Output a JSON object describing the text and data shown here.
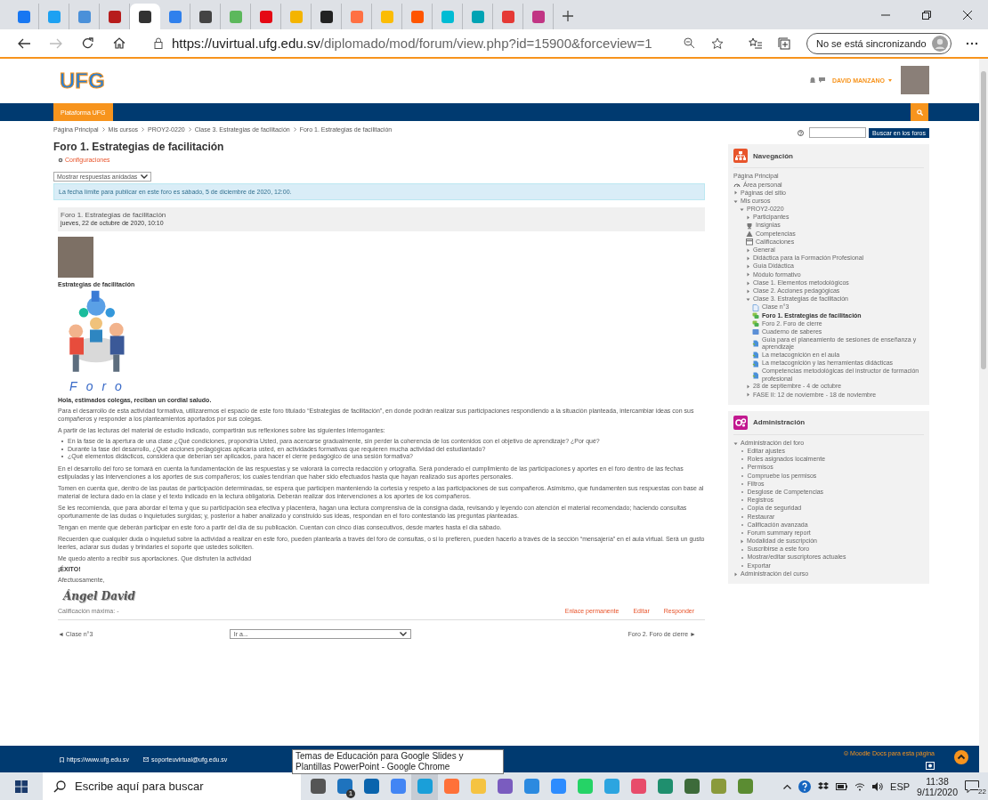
{
  "browser": {
    "tabs": [
      {
        "selected": false,
        "color": "#1877f2"
      },
      {
        "selected": false,
        "color": "#1da1f2"
      },
      {
        "selected": false,
        "color": "#4a90d9"
      },
      {
        "selected": false,
        "color": "#b71c1c"
      },
      {
        "selected": true,
        "color": "#333333"
      },
      {
        "selected": false,
        "color": "#2f80ed"
      },
      {
        "selected": false,
        "color": "#444444"
      },
      {
        "selected": false,
        "color": "#5cb85c"
      },
      {
        "selected": false,
        "color": "#e50914"
      },
      {
        "selected": false,
        "color": "#f4b400"
      },
      {
        "selected": false,
        "color": "#222222"
      },
      {
        "selected": false,
        "color": "#ff7043"
      },
      {
        "selected": false,
        "color": "#fbbc05"
      },
      {
        "selected": false,
        "color": "#ff5500"
      },
      {
        "selected": false,
        "color": "#00bcd4"
      },
      {
        "selected": false,
        "color": "#00a3b4"
      },
      {
        "selected": false,
        "color": "#e53935"
      },
      {
        "selected": false,
        "color": "#c13584"
      }
    ],
    "url_host": "https://uvirtual.ufg.edu.sv",
    "url_path": "/diplomado/mod/forum/view.php?id=15900&forceview=1",
    "sync_status": "No se está sincronizando"
  },
  "site_header": {
    "logo": "UFG",
    "user_name": "DAVID MANZANO"
  },
  "nav_bar": {
    "home_button": "Plataforma UFG"
  },
  "breadcrumb": [
    "Página Principal",
    "Mis cursos",
    "PROY2-0220",
    "Clase 3. Estrategias de facilitación",
    "Foro 1. Estrategias de facilitación"
  ],
  "forum_search": {
    "button": "Buscar en los foros"
  },
  "page_title": "Foro 1. Estrategias de facilitación",
  "settings_link": "Configuraciones",
  "display_mode": "Mostrar respuestas anidadas",
  "notice": "La fecha límite para publicar en este foro es sábado, 5 de diciembre de 2020, 12:00.",
  "post": {
    "subject": "Foro 1. Estrategias de facilitación",
    "date": "jueves, 22 de octubre de 2020, 10:10",
    "heading": "Estrategias de facilitación",
    "illustration_caption": "Foro",
    "blocks": [
      {
        "kind": "strong",
        "text": "Hola, estimados colegas, reciban un cordial saludo."
      },
      {
        "kind": "paragraph",
        "text": "Para el desarrollo de esta actividad formativa, utilizaremos el espacio de este foro titulado “Estrategias de facilitación”, en donde podrán realizar sus participaciones respondiendo a la situación planteada, intercambiar ideas con sus compañeros y responder a los planteamientos aportados por sus colegas."
      },
      {
        "kind": "paragraph",
        "text": "A partir de las lecturas del material de estudio indicado, compartirán sus reflexiones sobre las siguientes interrogantes:"
      },
      {
        "kind": "list",
        "items": [
          "En la fase de la apertura de una clase ¿Qué condiciones, propondría Usted, para acercarse gradualmente, sin perder la coherencia de los contenidos con el objetivo de aprendizaje? ¿Por qué?",
          "Durante la fase del desarrollo, ¿Qué acciones pedagógicas aplicaría usted, en actividades formativas que requieren mucha actividad del estudiantado?",
          "¿Qué elementos didácticos, considera que deberían ser aplicados, para hacer el cierre pedagógico de una sesión formativa?"
        ]
      },
      {
        "kind": "paragraph",
        "text": "En el desarrollo del foro se tomará en cuenta la fundamentación de las respuestas y se valorará la correcta redacción y ortografía. Será ponderado el cumplimiento de las participaciones y aportes en el foro dentro de las fechas estipuladas y las intervenciones a los aportes de sus compañeros; los cuales tendrían que haber sido efectuados hasta que hayan realizado sus aportes personales."
      },
      {
        "kind": "paragraph",
        "text": "Tomen en cuenta que, dentro de las pautas de participación determinadas, se espera que participen manteniendo la cortesía y respeto a las participaciones de sus compañeros. Asimismo, que fundamenten sus respuestas con base al material de lectura dado en la clase y el texto indicado en la lectura obligatoria. Deberán realizar dos intervenciones a los aportes de los compañeros."
      },
      {
        "kind": "paragraph",
        "text": "Se les recomienda, que para abordar el tema y que su participación sea efectiva y placentera, hagan una lectura comprensiva de la consigna dada, revisando y leyendo con atención el material recomendado; haciendo consultas oportunamente de las dudas o inquietudes surgidas; y, posterior a haber analizado y construido sus ideas, respondan en el foro contestando las preguntas planteadas."
      },
      {
        "kind": "paragraph",
        "text": "Tengan en mente que deberán participar en este foro a partir del día de su publicación. Cuentan con cinco días consecutivos, desde martes hasta el día sábado."
      },
      {
        "kind": "paragraph",
        "text": "Recuerden que cualquier duda o inquietud sobre la actividad a realizar en este foro, pueden plantearla a través del foro de consultas, o si lo prefieren, pueden hacerlo a través de la sección “mensajería” en el aula virtual. Será un gusto leerles, aclarar sus dudas y brindarles el soporte que ustedes soliciten."
      },
      {
        "kind": "paragraph",
        "text": "Me quedo atento a recibir sus aportaciones. Que disfruten la actividad"
      },
      {
        "kind": "strong",
        "text": "¡ÉXITO!"
      },
      {
        "kind": "paragraph",
        "text": "Afectuosamente,"
      }
    ],
    "signature": "Ángel David",
    "grade": "Calificación máxima: -",
    "actions": [
      "Enlace permanente",
      "Editar",
      "Responder"
    ]
  },
  "pager": {
    "previous": "◄ Clase n°3",
    "jump": "Ir a...",
    "next": "Foro 2. Foro de cierre ►"
  },
  "navigation": {
    "title": "Navegación",
    "items": [
      {
        "kind": "link",
        "label": "Página Principal",
        "selected": false
      },
      {
        "kind": "dashboard",
        "label": "Área personal",
        "selected": false
      },
      {
        "kind": "branch",
        "label": "Páginas del sitio",
        "expanded": false,
        "selected": false
      },
      {
        "kind": "branch",
        "label": "Mis cursos",
        "expanded": true,
        "selected": false,
        "children": [
          {
            "kind": "branch",
            "label": "PROY2-0220",
            "expanded": true,
            "selected": false,
            "children": [
              {
                "kind": "branch",
                "label": "Participantes",
                "expanded": false,
                "selected": false
              },
              {
                "kind": "badge",
                "label": "Insignias",
                "selected": false
              },
              {
                "kind": "competency",
                "label": "Competencias",
                "selected": false
              },
              {
                "kind": "grades",
                "label": "Calificaciones",
                "selected": false
              },
              {
                "kind": "branch",
                "label": "General",
                "expanded": false,
                "selected": false
              },
              {
                "kind": "branch",
                "label": "Didáctica para la Formación Profesional",
                "expanded": false,
                "selected": false
              },
              {
                "kind": "branch",
                "label": "Guía Didáctica",
                "expanded": false,
                "selected": false
              },
              {
                "kind": "branch",
                "label": "Módulo formativo",
                "expanded": false,
                "selected": false
              },
              {
                "kind": "branch",
                "label": "Clase 1. Elementos metodológicos",
                "expanded": false,
                "selected": false
              },
              {
                "kind": "branch",
                "label": "Clase 2. Acciones pedagógicas",
                "expanded": false,
                "selected": false
              },
              {
                "kind": "branch",
                "label": "Clase 3. Estrategias de facilitación",
                "expanded": true,
                "selected": false,
                "children": [
                  {
                    "kind": "page",
                    "label": "Clase n°3",
                    "selected": false
                  },
                  {
                    "kind": "forum",
                    "label": "Foro 1. Estrategias de facilitación",
                    "selected": true
                  },
                  {
                    "kind": "forum",
                    "label": "Foro 2. Foro de cierre",
                    "selected": false
                  },
                  {
                    "kind": "glossary",
                    "label": "Cuaderno de saberes",
                    "selected": false
                  },
                  {
                    "kind": "resource",
                    "label": "Guía para el planeamiento de sesiones de enseñanza y aprendizaje",
                    "selected": false
                  },
                  {
                    "kind": "resource",
                    "label": "La metacognición en el aula",
                    "selected": false
                  },
                  {
                    "kind": "resource",
                    "label": "La metacognición y las herramientas didácticas",
                    "selected": false
                  },
                  {
                    "kind": "resource",
                    "label": "Competencias metodológicas del instructor de formación profesional",
                    "selected": false
                  }
                ]
              },
              {
                "kind": "branch",
                "label": "28 de septiembre - 4 de octubre",
                "expanded": false,
                "selected": false
              },
              {
                "kind": "branch",
                "label": "FASE II: 12 de noviembre - 18 de noviembre",
                "expanded": false,
                "selected": false
              }
            ]
          }
        ]
      }
    ]
  },
  "administration": {
    "title": "Administración",
    "items": [
      {
        "kind": "branch",
        "label": "Administración del foro",
        "expanded": true,
        "children": [
          {
            "kind": "item",
            "label": "Editar ajustes"
          },
          {
            "kind": "item",
            "label": "Roles asignados localmente"
          },
          {
            "kind": "item",
            "label": "Permisos"
          },
          {
            "kind": "item",
            "label": "Compruebe los permisos"
          },
          {
            "kind": "item",
            "label": "Filtros"
          },
          {
            "kind": "item",
            "label": "Desglose de Competencias"
          },
          {
            "kind": "item",
            "label": "Registros"
          },
          {
            "kind": "item",
            "label": "Copia de seguridad"
          },
          {
            "kind": "item",
            "label": "Restaurar"
          },
          {
            "kind": "item",
            "label": "Calificación avanzada"
          },
          {
            "kind": "item",
            "label": "Forum summary report"
          },
          {
            "kind": "branch",
            "label": "Modalidad de suscripción",
            "expanded": false
          },
          {
            "kind": "item",
            "label": "Suscribirse a este foro"
          },
          {
            "kind": "item",
            "label": "Mostrar/editar suscriptores actuales"
          },
          {
            "kind": "item",
            "label": "Exportar"
          }
        ]
      },
      {
        "kind": "branch",
        "label": "Administración del curso",
        "expanded": false
      }
    ]
  },
  "footer": {
    "links": [
      {
        "kind": "web",
        "label": "https://www.ufg.edu.sv"
      },
      {
        "kind": "mail",
        "label": "soporteuvirtual@ufg.edu.sv"
      }
    ],
    "docs_link": "Moodle Docs para esta página"
  },
  "tooltip": "Temas de Educación para Google Slides y Plantillas PowerPoint - Google Chrome",
  "taskbar": {
    "search_placeholder": "Escribe aquí para buscar",
    "apps": [
      {
        "color": "#555555",
        "selected": false
      },
      {
        "color": "#1e73be",
        "selected": false,
        "badge": "1"
      },
      {
        "color": "#0a64ad",
        "selected": false
      },
      {
        "color": "#4285f4",
        "selected": false
      },
      {
        "color": "#1a9fd9",
        "selected": true
      },
      {
        "color": "#ff7139",
        "selected": false
      },
      {
        "color": "#f5c342",
        "selected": false
      },
      {
        "color": "#7a5cbf",
        "selected": false
      },
      {
        "color": "#2b8ae0",
        "selected": false
      },
      {
        "color": "#2d8cff",
        "selected": false
      },
      {
        "color": "#25d366",
        "selected": false
      },
      {
        "color": "#2ca5e0",
        "selected": false
      },
      {
        "color": "#e84c6b",
        "selected": false
      },
      {
        "color": "#1f8f6e",
        "selected": false
      },
      {
        "color": "#3d6b3a",
        "selected": false
      },
      {
        "color": "#8a9a3b",
        "selected": false
      },
      {
        "color": "#5b8c32",
        "selected": false
      }
    ],
    "language": "ESP",
    "time": "11:38",
    "date": "9/11/2020",
    "notifications": "22"
  }
}
